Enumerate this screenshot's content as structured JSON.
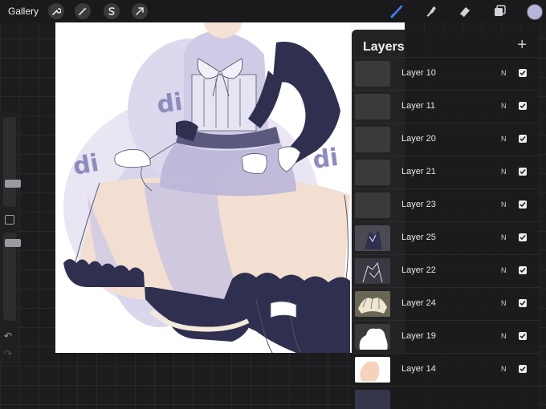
{
  "topbar": {
    "gallery_label": "Gallery",
    "left_tools": [
      "wrench-icon",
      "magic-wand-icon",
      "selection-s-icon",
      "transform-arrow-icon"
    ],
    "right_tools": [
      "brush-icon",
      "smudge-icon",
      "eraser-icon",
      "layers-icon"
    ],
    "accent_color": "#3f7ef0",
    "current_color": "#b7b5d8"
  },
  "canvas": {
    "lettering": [
      "di",
      "di",
      "di"
    ]
  },
  "layers_panel": {
    "title": "Layers",
    "add_label": "+",
    "items": [
      {
        "name": "Layer 10",
        "blend": "N",
        "visible": true
      },
      {
        "name": "Layer 11",
        "blend": "N",
        "visible": true
      },
      {
        "name": "Layer 20",
        "blend": "N",
        "visible": true
      },
      {
        "name": "Layer 21",
        "blend": "N",
        "visible": true
      },
      {
        "name": "Layer 23",
        "blend": "N",
        "visible": true
      },
      {
        "name": "Layer 25",
        "blend": "N",
        "visible": true
      },
      {
        "name": "Layer 22",
        "blend": "N",
        "visible": true
      },
      {
        "name": "Layer 24",
        "blend": "N",
        "visible": true
      },
      {
        "name": "Layer 19",
        "blend": "N",
        "visible": true
      },
      {
        "name": "Layer 14",
        "blend": "N",
        "visible": true
      }
    ]
  },
  "sidebar": {
    "undo_icon": "undo-icon",
    "redo_icon": "redo-icon"
  }
}
